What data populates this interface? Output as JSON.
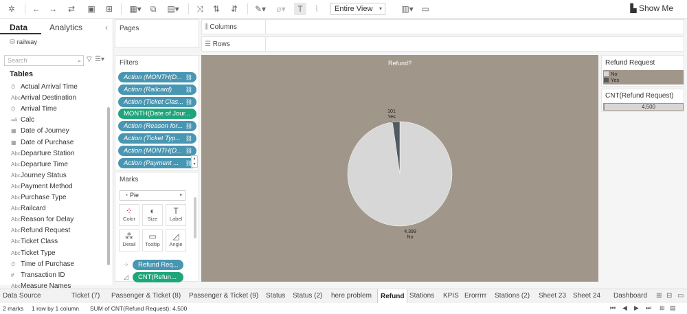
{
  "toolbar": {
    "view_select": "Entire View",
    "show_me": "Show Me"
  },
  "left_pane": {
    "tabs": [
      "Data",
      "Analytics"
    ],
    "datasource": "railway",
    "search_placeholder": "Search",
    "tables_heading": "Tables",
    "fields": [
      "Actual Arrival Time",
      "Arrival Destination",
      "Arrival Time",
      "Calc",
      "Date of Journey",
      "Date of Purchase",
      "Departure Station",
      "Departure Time",
      "Journey Status",
      "Payment Method",
      "Purchase Type",
      "Railcard",
      "Reason for Delay",
      "Refund Request",
      "Ticket Class",
      "Ticket Type",
      "Time of Purchase",
      "Transaction ID",
      "Measure Names"
    ]
  },
  "shelves": {
    "pages": "Pages",
    "columns": "Columns",
    "rows": "Rows",
    "filters": "Filters",
    "marks": "Marks"
  },
  "filters": [
    "Action (MONTH(D...",
    "Action (Railcard)",
    "Action (Ticket Clas...",
    "MONTH(Date of Jour...",
    "Action (Reason for...",
    "Action (Ticket Typ...",
    "Action (MONTH(D...",
    "Action (Payment ..."
  ],
  "marks": {
    "type": "Pie",
    "cards": [
      "Color",
      "Size",
      "Label",
      "Detail",
      "Tooltip",
      "Angle"
    ],
    "pills": [
      "Refund Req...",
      "CNT(Refun..."
    ]
  },
  "chart_data": {
    "type": "pie",
    "title": "Refund?",
    "categories": [
      "No",
      "Yes"
    ],
    "values": [
      4399,
      101
    ],
    "labels": [
      "4,399\nNo",
      "101\nYes"
    ],
    "colors": [
      "#d7d7d7",
      "#525a62"
    ]
  },
  "legend": {
    "title": "Refund Request",
    "items": [
      {
        "label": "No",
        "color": "#d7d7d7"
      },
      {
        "label": "Yes",
        "color": "#525a62"
      }
    ],
    "size_title": "CNT(Refund Request)",
    "size_value": "4,500"
  },
  "sheet_tabs": [
    "Data Source",
    "Ticket (7)",
    "Passenger & Ticket (8)",
    "Passenger & Ticket (9)",
    "Status",
    "Status (2)",
    "here problem",
    "Refund",
    "Stations",
    "KPIS",
    "Erorrrrr",
    "Stations (2)",
    "Sheet 23",
    "Sheet 24",
    "Dashboard"
  ],
  "active_tab": "Refund",
  "status": {
    "marks": "2 marks",
    "rows": "1 row by 1 column",
    "sum": "SUM of CNT(Refund Request): 4,500"
  }
}
